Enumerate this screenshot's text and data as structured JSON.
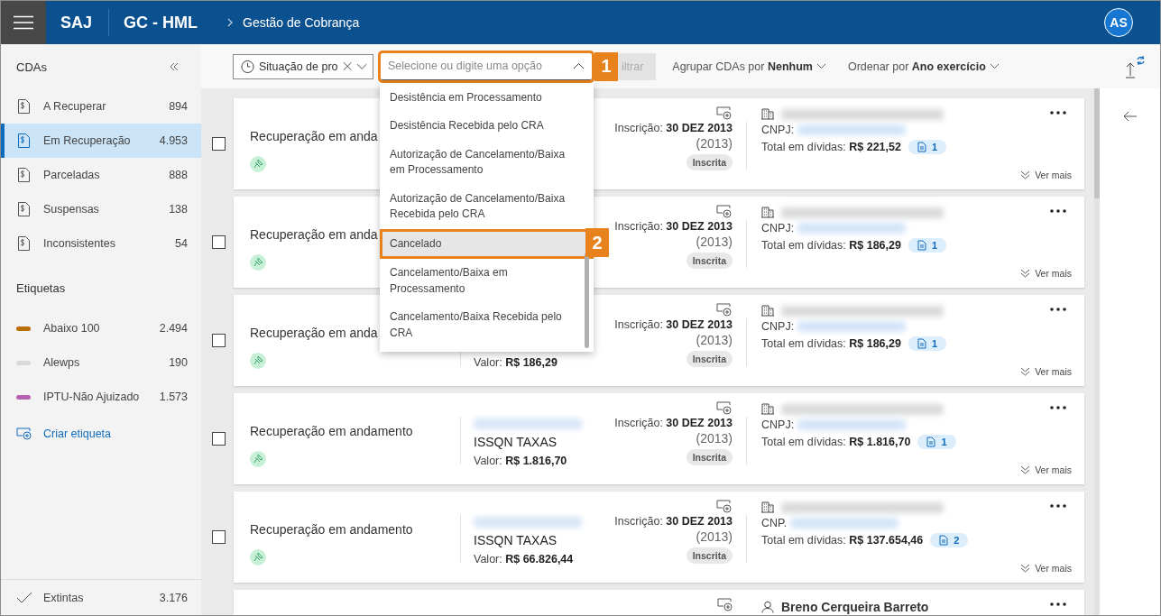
{
  "header": {
    "app": "SAJ",
    "module": "GC - HML",
    "breadcrumb": "Gestão de Cobrança",
    "avatar": "AS"
  },
  "sidebar": {
    "title": "CDAs",
    "items": [
      {
        "label": "A Recuperar",
        "count": "894",
        "selected": false
      },
      {
        "label": "Em Recuperação",
        "count": "4.953",
        "selected": true
      },
      {
        "label": "Parceladas",
        "count": "888",
        "selected": false
      },
      {
        "label": "Suspensas",
        "count": "138",
        "selected": false
      },
      {
        "label": "Inconsistentes",
        "count": "54",
        "selected": false
      }
    ],
    "tags_title": "Etiquetas",
    "tags": [
      {
        "label": "Abaixo 100",
        "count": "2.494",
        "color": "#b86e00"
      },
      {
        "label": "Alewps",
        "count": "190",
        "color": "#d9d9d9"
      },
      {
        "label": "IPTU-Não Ajuizado",
        "count": "1.573",
        "color": "#b562b0"
      }
    ],
    "create_tag": "Criar etiqueta",
    "footer": {
      "label": "Extintas",
      "count": "3.176"
    }
  },
  "toolbar": {
    "filter_chip": {
      "label": "Situação de pro"
    },
    "combobox": {
      "placeholder": "Selecione ou digite uma opção",
      "expanded": true,
      "annotation": "1"
    },
    "filter_button": {
      "label": "iltrar",
      "disabled": true
    },
    "group_by": "Agrupar CDAs por **Nenhum**",
    "sort_by": "Ordenar por **Ano exercício**"
  },
  "dropdown": {
    "options": [
      {
        "label": "Desistência em Processamento",
        "selected": false
      },
      {
        "label": "Desistência Recebida pelo CRA",
        "selected": false
      },
      {
        "label": "Autorização de Cancelamento/Baixa em Processamento",
        "selected": false
      },
      {
        "label": "Autorização de Cancelamento/Baixa Recebida pelo CRA",
        "selected": false
      },
      {
        "label": "Cancelado",
        "selected": true,
        "annotation": "2"
      },
      {
        "label": "Cancelamento/Baixa em Processamento",
        "selected": false
      },
      {
        "label": "Cancelamento/Baixa Recebida pelo CRA",
        "selected": false
      }
    ]
  },
  "cards": [
    {
      "checked": false,
      "title": "Recuperação em anda",
      "inscricao": "Inscrição: **30 DEZ 2013**",
      "year": "(2013)",
      "status": "Inscrita",
      "kind": "company",
      "cnpj_label": "CNPJ:",
      "total": "Total em dívidas: **R$ 221,52**",
      "docs": "1",
      "more": "Ver mais"
    },
    {
      "checked": false,
      "title": "Recuperação em anda",
      "inscricao": "Inscrição: **30 DEZ 2013**",
      "year": "(2013)",
      "status": "Inscrita",
      "kind": "company",
      "cnpj_label": "CNPJ:",
      "total": "Total em dívidas: **R$ 186,29**",
      "docs": "1",
      "more": "Ver mais"
    },
    {
      "checked": false,
      "title": "Recuperação em anda",
      "value": "Valor: **R$ 186,29**",
      "inscricao": "Inscrição: **30 DEZ 2013**",
      "year": "(2013)",
      "status": "Inscrita",
      "kind": "company",
      "cnpj_label": "CNPJ:",
      "total": "Total em dívidas: **R$ 186,29**",
      "docs": "1",
      "more": "Ver mais"
    },
    {
      "checked": false,
      "title": "Recuperação em andamento",
      "type": "ISSQN TAXAS",
      "value": "Valor: **R$ 1.816,70**",
      "inscricao": "Inscrição: **30 DEZ 2013**",
      "year": "(2013)",
      "status": "Inscrita",
      "kind": "company",
      "cnpj_label": "CNPJ:",
      "total": "Total em dívidas: **R$ 1.816,70**",
      "docs": "1",
      "more": "Ver mais"
    },
    {
      "checked": false,
      "title": "Recuperação em andamento",
      "type": "ISSQN TAXAS",
      "value": "Valor: **R$ 66.826,44**",
      "inscricao": "Inscrição: **30 DEZ 2013**",
      "year": "(2013)",
      "status": "Inscrita",
      "kind": "company",
      "cnpj_label": "CNP.",
      "total": "Total em dívidas: **R$ 137.654,46**",
      "docs": "2",
      "more": "Ver mais"
    },
    {
      "kind": "person",
      "owner_name": "Breno Cerqueira Barreto"
    }
  ]
}
